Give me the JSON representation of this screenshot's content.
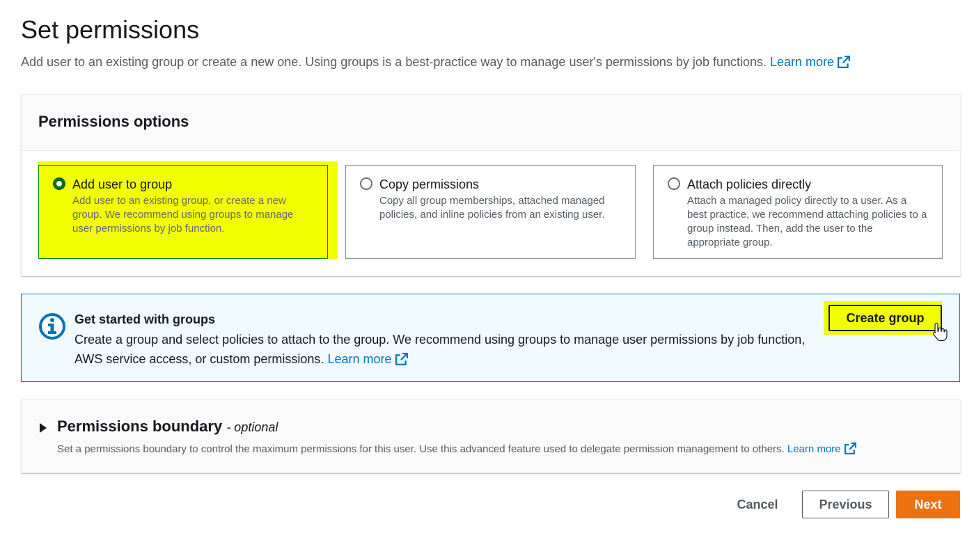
{
  "header": {
    "title": "Set permissions",
    "description": "Add user to an existing group or create a new one. Using groups is a best-practice way to manage user's permissions by job functions.",
    "learn_more": "Learn more"
  },
  "permissions_options": {
    "heading": "Permissions options",
    "options": [
      {
        "title": "Add user to group",
        "description": "Add user to an existing group, or create a new group. We recommend using groups to manage user permissions by job function.",
        "selected": true
      },
      {
        "title": "Copy permissions",
        "description": "Copy all group memberships, attached managed policies, and inline policies from an existing user.",
        "selected": false
      },
      {
        "title": "Attach policies directly",
        "description": "Attach a managed policy directly to a user. As a best practice, we recommend attaching policies to a group instead. Then, add the user to the appropriate group.",
        "selected": false
      }
    ]
  },
  "groups_alert": {
    "title": "Get started with groups",
    "body": "Create a group and select policies to attach to the group. We recommend using groups to manage user permissions by job function, AWS service access, or custom permissions.",
    "learn_more": "Learn more",
    "create_button": "Create group",
    "icon": "info-icon"
  },
  "permissions_boundary": {
    "title": "Permissions boundary",
    "optional": "- optional",
    "description": "Set a permissions boundary to control the maximum permissions for this user. Use this advanced feature used to delegate permission management to others.",
    "learn_more": "Learn more"
  },
  "footer": {
    "cancel": "Cancel",
    "previous": "Previous",
    "next": "Next"
  },
  "colors": {
    "highlight": "#f2ff00",
    "link": "#0073bb",
    "primary_button": "#ec7211",
    "selected_radio": "#0a6b18",
    "alert_border": "#0073bb",
    "alert_background": "#f1faff"
  }
}
